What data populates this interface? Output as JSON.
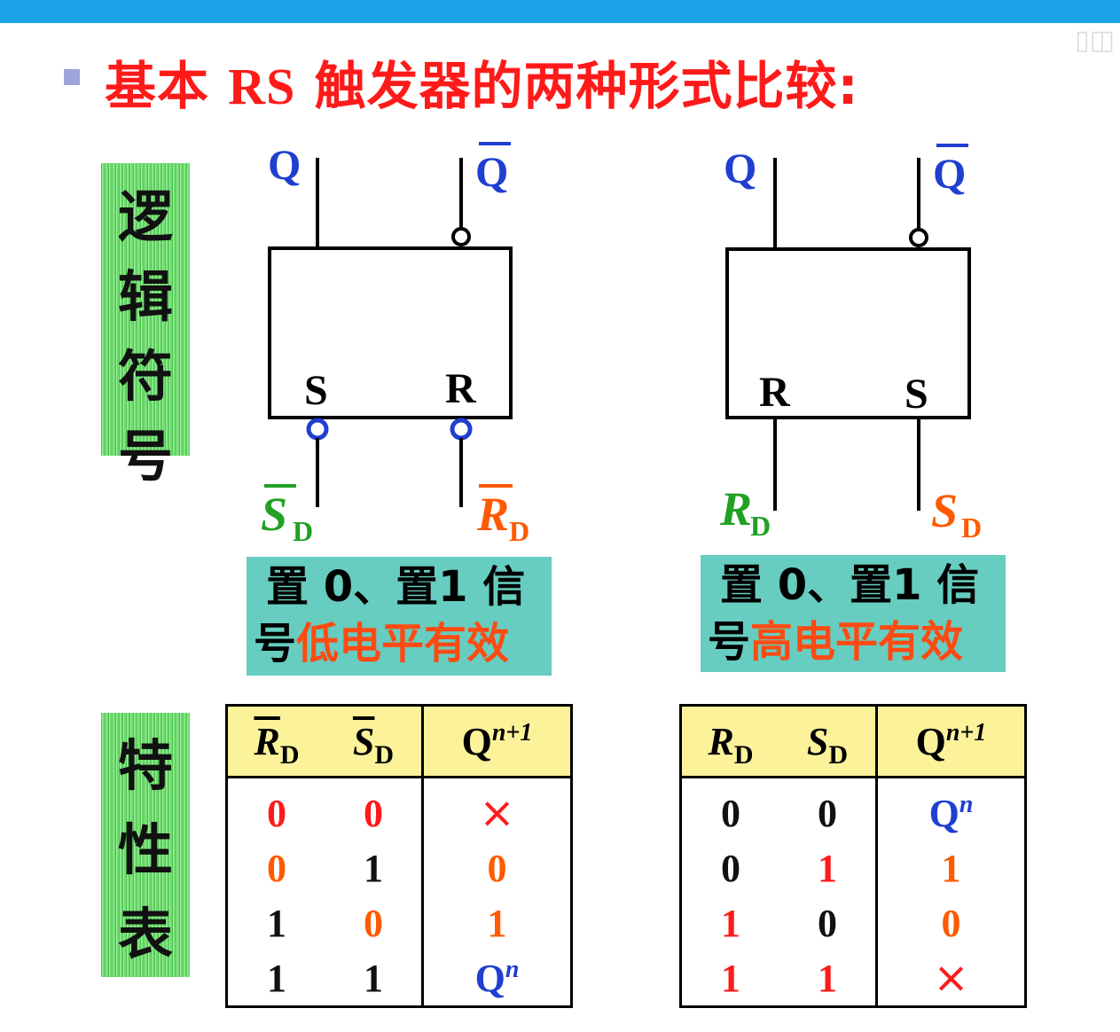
{
  "title": {
    "prefix": "基本 ",
    "latin": "RS",
    "suffix": " 触发器的两种形式比较:"
  },
  "side_labels": {
    "logic_symbol": [
      "逻",
      "辑",
      "符",
      "号"
    ],
    "char_table": [
      "特",
      "性",
      "表"
    ]
  },
  "left_symbol": {
    "q": "Q",
    "qbar": "Q",
    "s": "S",
    "r": "R",
    "in_left": "S",
    "in_right": "R",
    "sub": "D"
  },
  "right_symbol": {
    "q": "Q",
    "qbar": "Q",
    "r": "R",
    "s": "S",
    "in_left": "R",
    "in_right": "S",
    "sub": "D"
  },
  "notes": {
    "left": {
      "line1": "置 0、置1 信",
      "line2a": "号",
      "line2b": "低电平有效"
    },
    "right": {
      "line1": "置 0、置1 信",
      "line2a": "号",
      "line2b": "高电平有效"
    }
  },
  "table_left": {
    "headers": {
      "c1": "R",
      "c2": "S",
      "sub": "D",
      "c3": "Q",
      "c3_sup": "n+1"
    },
    "rows": [
      {
        "a": "0",
        "b": "0",
        "q": "×",
        "qsup": ""
      },
      {
        "a": "0",
        "b": "1",
        "q": "0",
        "qsup": ""
      },
      {
        "a": "1",
        "b": "0",
        "q": "1",
        "qsup": ""
      },
      {
        "a": "1",
        "b": "1",
        "q": "Q",
        "qsup": "n"
      }
    ]
  },
  "table_right": {
    "headers": {
      "c1": "R",
      "c2": "S",
      "sub": "D",
      "c3": "Q",
      "c3_sup": "n+1"
    },
    "rows": [
      {
        "a": "0",
        "b": "0",
        "q": "Q",
        "qsup": "n"
      },
      {
        "a": "0",
        "b": "1",
        "q": "1",
        "qsup": ""
      },
      {
        "a": "1",
        "b": "0",
        "q": "0",
        "qsup": ""
      },
      {
        "a": "1",
        "b": "1",
        "q": "×",
        "qsup": ""
      }
    ]
  },
  "colors": {
    "red": "#ff1a1a",
    "orange": "#ff5a00",
    "blue": "#1f3fd0",
    "green": "#22a022",
    "header_bg": "#fbf29a",
    "note_bg": "#66cdc0"
  }
}
